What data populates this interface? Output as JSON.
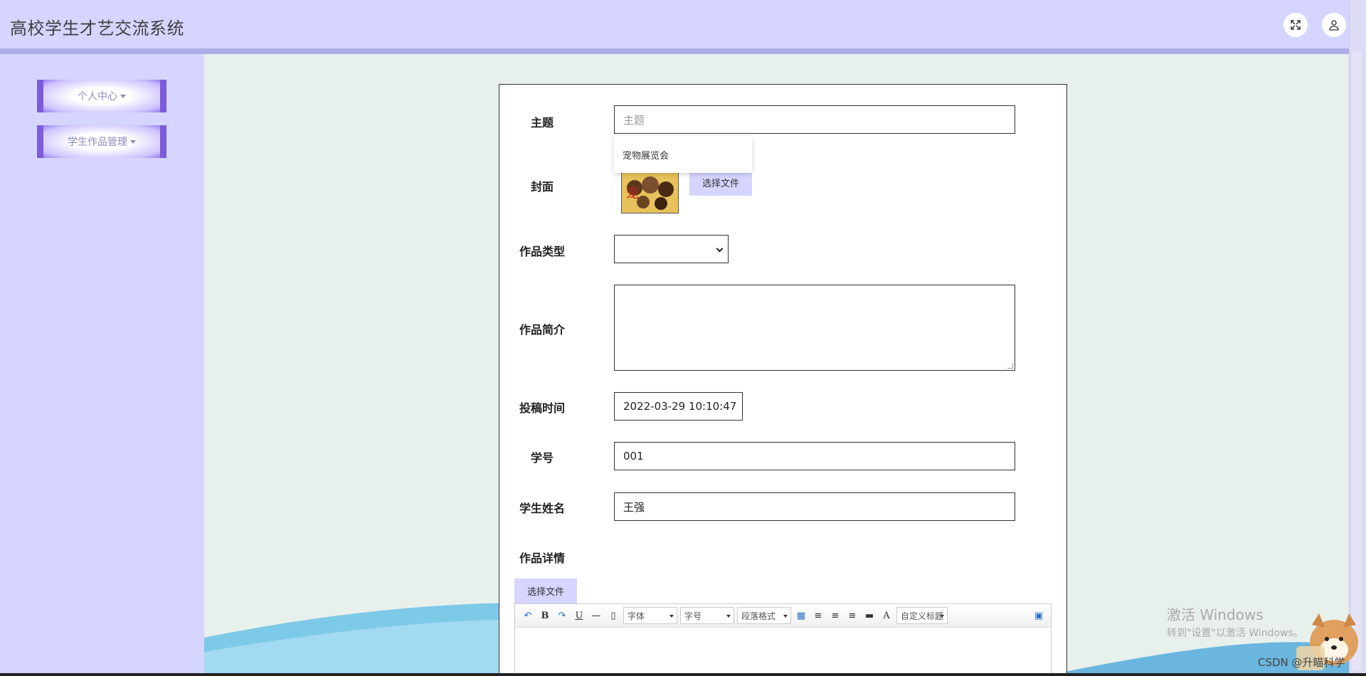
{
  "header": {
    "title": "高校学生才艺交流系统",
    "fullscreen_icon": "expand-icon",
    "user_icon": "user-icon"
  },
  "sidebar": {
    "items": [
      {
        "label": "个人中心"
      },
      {
        "label": "学生作品管理"
      }
    ]
  },
  "form": {
    "topic": {
      "label": "主题",
      "placeholder": "主题",
      "suggestion": "宠物展览会"
    },
    "cover": {
      "label": "封面",
      "button": "选择文件"
    },
    "type": {
      "label": "作品类型",
      "value": ""
    },
    "intro": {
      "label": "作品简介",
      "value": ""
    },
    "submit_time": {
      "label": "投稿时间",
      "value": "2022-03-29 10:10:47"
    },
    "student_no": {
      "label": "学号",
      "value": "001"
    },
    "student_name": {
      "label": "学生姓名",
      "value": "王强"
    },
    "detail": {
      "label": "作品详情",
      "button": "选择文件"
    }
  },
  "editor_toolbar": {
    "bold": "B",
    "underline": "U",
    "font_family": "字体",
    "font_size": "字号",
    "paragraph": "段落格式",
    "font_color": "A",
    "custom_title": "自定义标题"
  },
  "watermark": {
    "line1": "激活 Windows",
    "line2": "转到\"设置\"以激活 Windows。",
    "csdn": "CSDN @升瞄科学"
  },
  "colors": {
    "header_bg": "#d5d5ff",
    "accent": "#7d5cdc",
    "content_bg": "#e8f0ec"
  }
}
